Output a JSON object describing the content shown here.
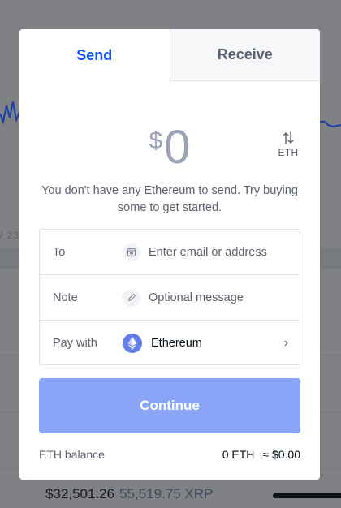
{
  "background": {
    "date_fragment": "/ 23",
    "bottom_fiat": "$32,501.26",
    "bottom_crypto": "55,519.75 XRP"
  },
  "tabs": [
    {
      "label": "Send",
      "active": true
    },
    {
      "label": "Receive",
      "active": false
    }
  ],
  "amount": {
    "currency_symbol": "$",
    "value": "0",
    "switch_unit": "ETH"
  },
  "notice": "You don't have any Ethereum to send. Try buying some to get started.",
  "form": {
    "to": {
      "label": "To",
      "placeholder": "Enter email or address",
      "icon": "contacts-icon"
    },
    "note": {
      "label": "Note",
      "placeholder": "Optional message",
      "icon": "pencil-icon"
    },
    "pay_with": {
      "label": "Pay with",
      "asset": "Ethereum",
      "icon": "ethereum-icon"
    }
  },
  "continue_label": "Continue",
  "balance": {
    "label": "ETH balance",
    "crypto": "0 ETH",
    "fiat": "≈ $0.00"
  },
  "colors": {
    "accent": "#1652f0",
    "button_disabled": "#8aa5f8",
    "eth": "#627eea"
  }
}
